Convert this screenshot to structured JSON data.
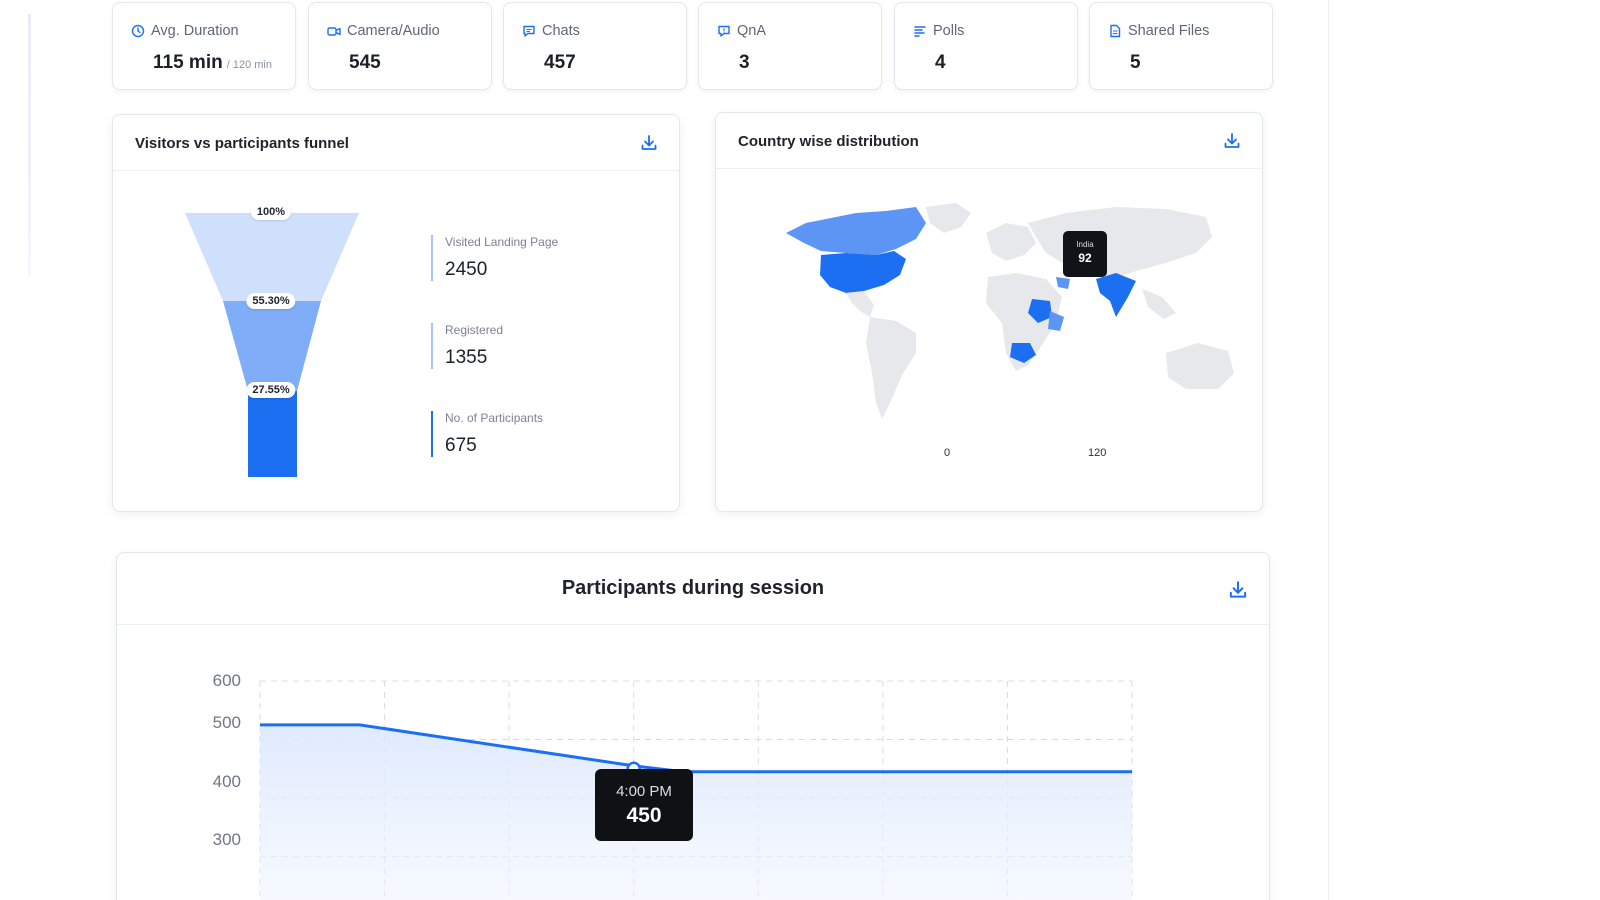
{
  "stats": [
    {
      "icon": "clock-icon",
      "label": "Avg. Duration",
      "value": "115 min",
      "sub": "/ 120 min"
    },
    {
      "icon": "camera-icon",
      "label": "Camera/Audio",
      "value": "545",
      "sub": ""
    },
    {
      "icon": "chat-icon",
      "label": "Chats",
      "value": "457",
      "sub": ""
    },
    {
      "icon": "qna-icon",
      "label": "QnA",
      "value": "3",
      "sub": ""
    },
    {
      "icon": "polls-icon",
      "label": "Polls",
      "value": "4",
      "sub": ""
    },
    {
      "icon": "file-icon",
      "label": "Shared Files",
      "value": "5",
      "sub": ""
    }
  ],
  "funnel": {
    "title": "Visitors vs participants funnel",
    "percent_labels": [
      "100%",
      "55.30%",
      "27.55%"
    ],
    "stages": [
      {
        "label": "Visited Landing Page",
        "value": "2450"
      },
      {
        "label": "Registered",
        "value": "1355"
      },
      {
        "label": "No. of Participants",
        "value": "675"
      }
    ]
  },
  "country_map": {
    "title": "Country wise distribution",
    "tooltip": {
      "country": "India",
      "value": "92"
    },
    "legend_min": "0",
    "legend_max": "120",
    "marker_value": 92
  },
  "session_chart": {
    "title": "Participants during session",
    "y_ticks": [
      "600",
      "500",
      "400",
      "300"
    ],
    "tooltip": {
      "time": "4:00 PM",
      "value": "450"
    }
  },
  "colors": {
    "accent": "#1d6ff2",
    "light": "#cfe0fd",
    "mid": "#7fadf7"
  },
  "chart_data": {
    "type": "area",
    "title": "Participants during session",
    "xlabel": "",
    "ylabel": "",
    "ylim": [
      300,
      600
    ],
    "y_ticks": [
      600,
      500,
      400,
      300
    ],
    "x_index": [
      0,
      0.8,
      3,
      3.4,
      7
    ],
    "series": [
      {
        "values": [
          525,
          525,
          455,
          445,
          445
        ]
      }
    ],
    "grid": true,
    "highlight": {
      "time": "4:00 PM",
      "value": 450
    }
  }
}
